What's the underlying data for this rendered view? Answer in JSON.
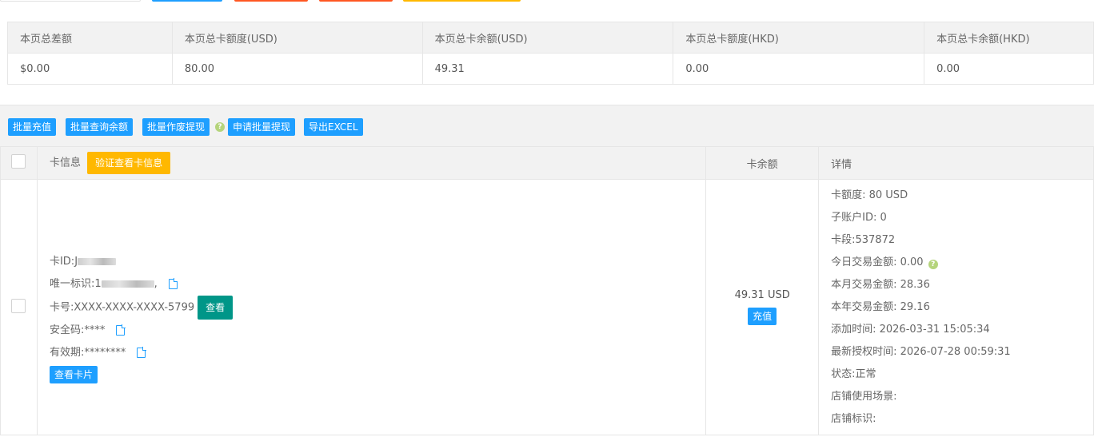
{
  "summary": {
    "headers": [
      "本页总差额",
      "本页总卡额度(USD)",
      "本页总卡余额(USD)",
      "本页总卡额度(HKD)",
      "本页总卡余额(HKD)"
    ],
    "values": [
      "$0.00",
      "80.00",
      "49.31",
      "0.00",
      "0.00"
    ]
  },
  "toolbar": {
    "batch_recharge": "批量充值",
    "batch_query_balance": "批量查询余额",
    "batch_void_withdraw": "批量作废提现",
    "help_icon": "?",
    "apply_batch_withdraw": "申请批量提现",
    "export_excel": "导出EXCEL"
  },
  "table": {
    "col_card_info": "卡信息",
    "verify_view_button": "验证查看卡信息",
    "col_balance": "卡余额",
    "col_details": "详情"
  },
  "row": {
    "card_id_label": "卡ID:",
    "card_id_prefix": "J",
    "unique_id_label": "唯一标识:",
    "unique_id_prefix": "1",
    "card_number": "卡号:XXXX-XXXX-XXXX-5799",
    "view_button": "查看",
    "cvv": "安全码:****",
    "expiry": "有效期:********",
    "view_card_button": "查看卡片",
    "balance": "49.31 USD",
    "recharge_button": "充值",
    "details": {
      "limit": "卡额度: 80 USD",
      "sub_account": "子账户ID: 0",
      "bin": "卡段:537872",
      "today_amount": "今日交易金额: 0.00",
      "month_amount": "本月交易金额: 28.36",
      "year_amount": "本年交易金额: 29.16",
      "added_time": "添加时间: 2026-03-31 15:05:34",
      "last_auth_time": "最新授权时间: 2026-07-28 00:59:31",
      "status": "状态:正常",
      "store_scene": "店铺使用场景:",
      "store_tag": "店铺标识:"
    }
  },
  "colors": {
    "blue": "#1e9fff",
    "green": "#009688",
    "orange": "#ffb800",
    "red": "#ff5722",
    "help_green": "#b5d47c"
  }
}
